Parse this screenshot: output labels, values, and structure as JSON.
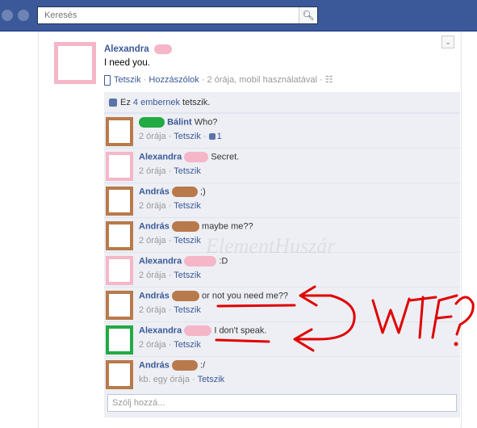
{
  "search": {
    "placeholder": "Keresés"
  },
  "colors": {
    "brand": "#3b5998",
    "pink": "#f5b6c8",
    "brown": "#b87a4b",
    "green": "#22aa44",
    "annotation_red": "#e00000"
  },
  "post": {
    "author": "Alexandra",
    "text": "I need you.",
    "actions": {
      "like": "Tetszik",
      "comment": "Hozzászólok",
      "time": "2 órája, mobil használatával"
    },
    "likes_prefix": "Ez ",
    "likes_count": "4 embernek",
    "likes_suffix": " tetszik.",
    "comments": [
      {
        "author": "Bálint",
        "text": "Who?",
        "time": "2 órája",
        "like": "Tetszik",
        "like_count": "1",
        "avatar": "brown",
        "blur": "green"
      },
      {
        "author": "Alexandra",
        "text": "Secret.",
        "time": "2 órája",
        "like": "Tetszik",
        "avatar": "pink",
        "blur": "pink"
      },
      {
        "author": "András",
        "text": ";)",
        "time": "2 órája",
        "like": "Tetszik",
        "avatar": "brown",
        "blur": "brown"
      },
      {
        "author": "András",
        "text": "maybe me??",
        "time": "2 órája",
        "like": "Tetszik",
        "avatar": "brown",
        "blur": "brown"
      },
      {
        "author": "Alexandra",
        "text": ":D",
        "time": "2 órája",
        "like": "Tetszik",
        "avatar": "pink",
        "blur": "pink"
      },
      {
        "author": "András",
        "text": "or not you need me??",
        "time": "2 órája",
        "like": "Tetszik",
        "avatar": "brown",
        "blur": "brown"
      },
      {
        "author": "Alexandra",
        "text": "I don't speak.",
        "time": "2 órája",
        "like": "Tetszik",
        "avatar": "green",
        "blur": "pink"
      },
      {
        "author": "András",
        "text": ":/",
        "time": "kb. egy órája",
        "like": "Tetszik",
        "avatar": "brown",
        "blur": "brown"
      }
    ],
    "reply_placeholder": "Szólj hozzá..."
  },
  "annotation": {
    "text": "WTF?"
  },
  "watermark": "ElementHuszár"
}
